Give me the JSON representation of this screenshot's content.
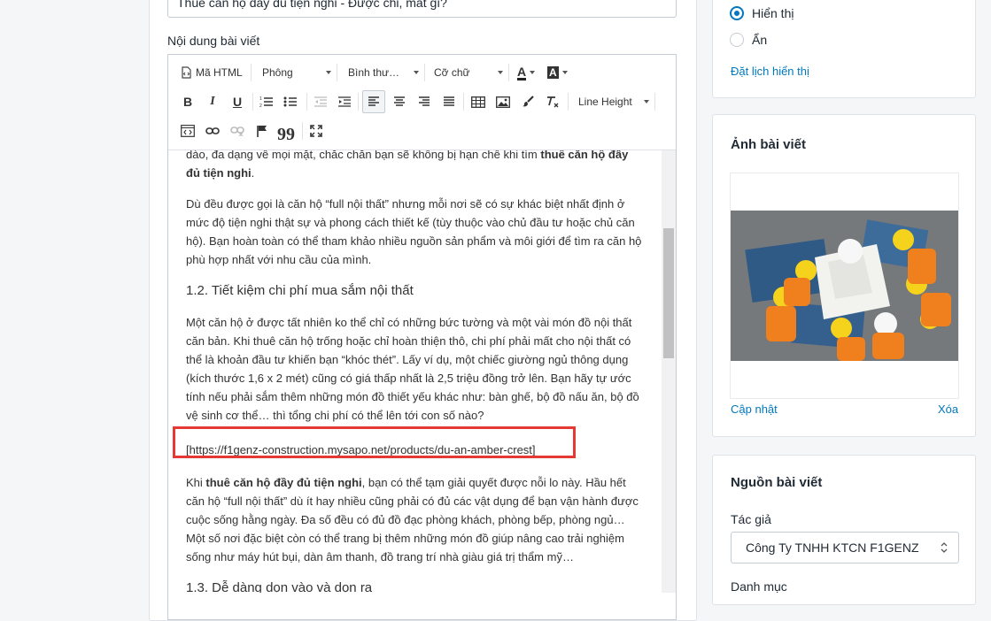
{
  "title_input": {
    "value": "Thuê căn hộ đầy đủ tiện nghi - Được chi, mất gì?"
  },
  "content_label": "Nội dung bài viết",
  "toolbar": {
    "html_label": "Mã HTML",
    "font_label": "Phông",
    "style_label": "Bình thư…",
    "size_label": "Cỡ chữ",
    "line_height_label": "Line Height",
    "text_color_glyph": "A",
    "bg_color_glyph": "A",
    "bold_glyph": "B",
    "italic_glyph": "I",
    "underline_glyph": "U",
    "quote_glyph": "99"
  },
  "content": {
    "p0_a": "dào, đa dạng về mọi mặt, chắc chắn bạn sẽ không bị hạn chế khi tìm ",
    "p0_b": "thuê căn hộ đầy đủ tiện nghi",
    "p0_c": ".",
    "p1": "Dù đều được gọi là căn hộ “full nội thất” nhưng mỗi nơi sẽ có sự khác biệt nhất định ở mức độ tiện nghi thật sự và phong cách thiết kế (tùy thuộc vào chủ đầu tư hoặc chủ căn hộ). Bạn hoàn toàn có thể tham khảo nhiều nguồn sản phẩm và môi giới để tìm ra căn hộ phù hợp nhất với nhu cầu của mình.",
    "h2": "1.2. Tiết kiệm chi phí mua sắm nội thất",
    "p2": "Một căn hộ ở được tất nhiên ko thể chỉ có những bức tường và một vài món đồ nội thất căn bản. Khi thuê căn hộ trống hoặc chỉ hoàn thiện thô, chi phí phải mất cho nội thất có thể là khoản đầu tư khiến bạn “khóc thét”. Lấy ví dụ, một chiếc giường ngủ thông dụng (kích thước 1,6 x 2 mét) cũng có giá thấp nhất là 2,5 triệu đồng trở lên. Bạn hãy tự ước tính nếu phải sắm thêm những món đồ thiết yếu khác như: bàn ghế, bộ đồ nấu ăn, bộ đồ vệ sinh cơ thể… thì tổng chi phí có thể lên tới con số nào?",
    "link_line": "[https://f1genz-construction.mysapo.net/products/du-an-amber-crest]",
    "p3_a": "Khi ",
    "p3_b": "thuê căn hộ đầy đủ tiện nghi",
    "p3_c": ", bạn có thể tạm giải quyết được nỗi lo này. Hầu hết căn hộ “full nội thất” dù ít hay nhiều cũng phải có đủ các vật dụng để bạn vận hành được cuộc sống hằng ngày. Đa số đều có đủ đồ đạc phòng khách, phòng bếp, phòng ngủ… Một số nơi đặc biệt còn có thể trang bị thêm những món đồ giúp nâng cao trải nghiệm sống như máy hút bụi, dàn âm thanh, đồ trang trí nhà giàu giá trị thẩm mỹ…",
    "h3": "1.3. Dễ dàng dọn vào và dọn ra"
  },
  "visibility": {
    "option_show": "Hiển thị",
    "option_hide": "Ẩn",
    "schedule_link": "Đặt lịch hiển thị",
    "selected": "Hiển thị"
  },
  "image_card": {
    "title": "Ảnh bài viết",
    "update_link": "Cập nhật",
    "delete_link": "Xóa"
  },
  "source_card": {
    "title": "Nguồn bài viết",
    "author_label": "Tác giả",
    "author_value": "Công Ty TNHH KTCN F1GENZ",
    "category_label": "Danh mục"
  },
  "colors": {
    "accent": "#0078bd",
    "highlight": "#e53935",
    "background": "#f4f6f8"
  }
}
